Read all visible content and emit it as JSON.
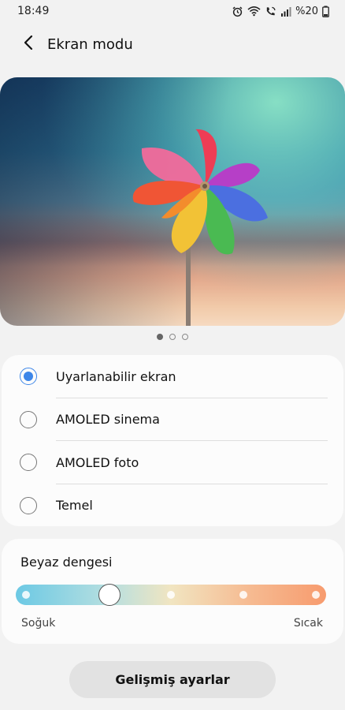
{
  "status_bar": {
    "time": "18:49",
    "battery": "%20",
    "icons": [
      "alarm-icon",
      "wifi-icon",
      "wifi-call-icon",
      "signal-icon"
    ]
  },
  "header": {
    "title": "Ekran modu",
    "back_icon": "chevron-left-icon"
  },
  "preview": {
    "image": "pinwheel-photo",
    "pages": 3,
    "active_page": 1
  },
  "modes": {
    "selected_index": 0,
    "items": [
      {
        "label": "Uyarlanabilir ekran"
      },
      {
        "label": "AMOLED sinema"
      },
      {
        "label": "AMOLED foto"
      },
      {
        "label": "Temel"
      }
    ]
  },
  "white_balance": {
    "title": "Beyaz dengesi",
    "min_label": "Soğuk",
    "max_label": "Sıcak",
    "steps": 5,
    "value_step": 2
  },
  "advanced_button": {
    "label": "Gelişmiş ayarlar"
  },
  "colors": {
    "accent": "#3d86e8",
    "background": "#f2f2f2",
    "card": "#fcfcfc",
    "slider_cold": "#6cc9e4",
    "slider_warm": "#f79b6e"
  }
}
